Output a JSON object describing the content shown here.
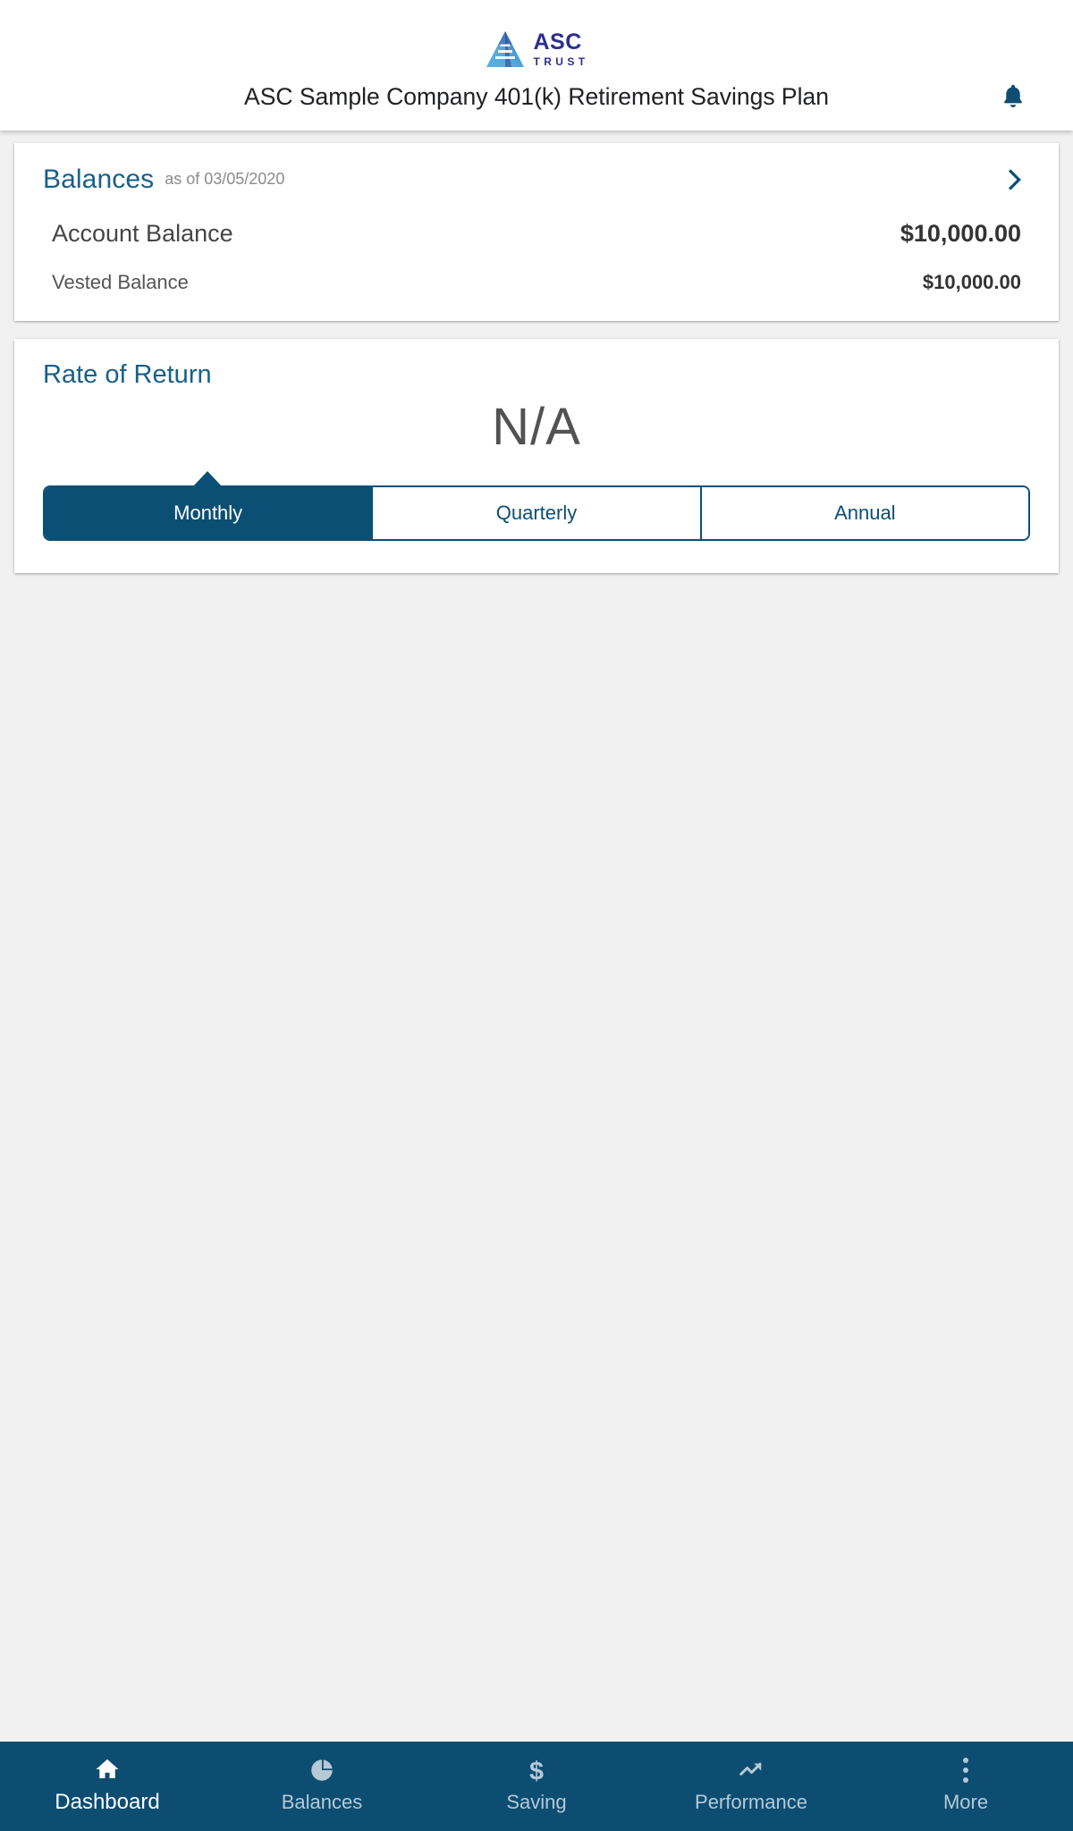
{
  "header": {
    "logo": {
      "mark_name": "asc-pyramid-logo",
      "primary_text": "ASC",
      "secondary_text": "TRUST",
      "color": "#2c2f8f"
    },
    "plan_title": "ASC Sample Company 401(k) Retirement Savings Plan",
    "notification_icon": "bell-icon",
    "notification_color": "#0d4d71"
  },
  "balances_card": {
    "title": "Balances",
    "as_of_label": "as of 03/05/2020",
    "title_color": "#17608a",
    "chevron_icon": "chevron-right-icon",
    "rows": [
      {
        "label": "Account Balance",
        "value": "$10,000.00"
      },
      {
        "label": "Vested Balance",
        "value": "$10,000.00"
      }
    ]
  },
  "rate_of_return_card": {
    "title": "Rate of Return",
    "value": "N/A",
    "title_color": "#17608a",
    "accent_color": "#0b4f74",
    "periods": [
      {
        "label": "Monthly",
        "selected": true
      },
      {
        "label": "Quarterly",
        "selected": false
      },
      {
        "label": "Annual",
        "selected": false
      }
    ]
  },
  "bottom_nav": {
    "background_color": "#0d4d71",
    "active_color": "#ffffff",
    "inactive_color": "#b6c9d6",
    "items": [
      {
        "label": "Dashboard",
        "icon": "home-icon",
        "active": true
      },
      {
        "label": "Balances",
        "icon": "pie-chart-icon",
        "active": false
      },
      {
        "label": "Saving",
        "icon": "dollar-sign-icon",
        "active": false
      },
      {
        "label": "Performance",
        "icon": "trending-up-icon",
        "active": false
      },
      {
        "label": "More",
        "icon": "more-vertical-icon",
        "active": false
      }
    ]
  }
}
